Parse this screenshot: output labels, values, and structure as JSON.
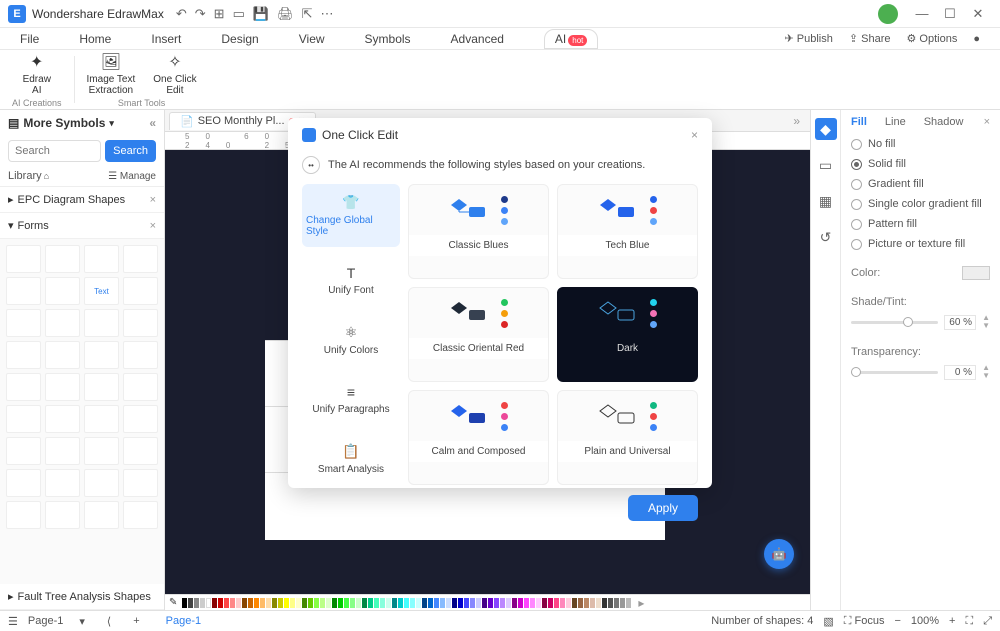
{
  "app": {
    "title": "Wondershare EdrawMax"
  },
  "menu": {
    "items": [
      "File",
      "Home",
      "Insert",
      "Design",
      "View",
      "Symbols",
      "Advanced"
    ],
    "ai": "AI",
    "ai_badge": "hot",
    "right": {
      "publish": "Publish",
      "share": "Share",
      "options": "Options"
    }
  },
  "ribbon": {
    "group1_label": "AI Creations",
    "group2_label": "Smart Tools",
    "items": {
      "edraw_ai": "Edraw\nAI",
      "image_text": "Image Text\nExtraction",
      "one_click": "One Click\nEdit"
    }
  },
  "leftpanel": {
    "title": "More Symbols",
    "search_placeholder": "Search",
    "search_btn": "Search",
    "library": "Library",
    "manage": "Manage",
    "categories": {
      "epc": "EPC Diagram Shapes",
      "forms": "Forms",
      "fault": "Fault Tree Analysis Shapes"
    }
  },
  "tab": {
    "label": "SEO Monthly Pl..."
  },
  "modal": {
    "title": "One Click Edit",
    "message": "The AI recommends the following styles based on your creations.",
    "apply": "Apply",
    "side": {
      "global": "Change Global Style",
      "font": "Unify Font",
      "colors": "Unify Colors",
      "paragraphs": "Unify Paragraphs",
      "analysis": "Smart Analysis"
    },
    "styles": {
      "classic_blues": "Classic Blues",
      "tech_blue": "Tech Blue",
      "classic_red": "Classic Oriental Red",
      "dark": "Dark",
      "calm": "Calm and Composed",
      "plain": "Plain and Universal"
    }
  },
  "rightpanel": {
    "tabs": {
      "fill": "Fill",
      "line": "Line",
      "shadow": "Shadow"
    },
    "options": {
      "no_fill": "No fill",
      "solid": "Solid fill",
      "gradient": "Gradient fill",
      "single_gradient": "Single color gradient fill",
      "pattern": "Pattern fill",
      "picture": "Picture or texture fill"
    },
    "labels": {
      "color": "Color:",
      "shade": "Shade/Tint:",
      "transparency": "Transparency:"
    },
    "values": {
      "shade": "60 %",
      "transparency": "0 %"
    }
  },
  "status": {
    "page": "Page-1",
    "page_tab": "Page-1",
    "shapes": "Number of shapes: 4",
    "focus": "Focus",
    "zoom": "100%"
  }
}
